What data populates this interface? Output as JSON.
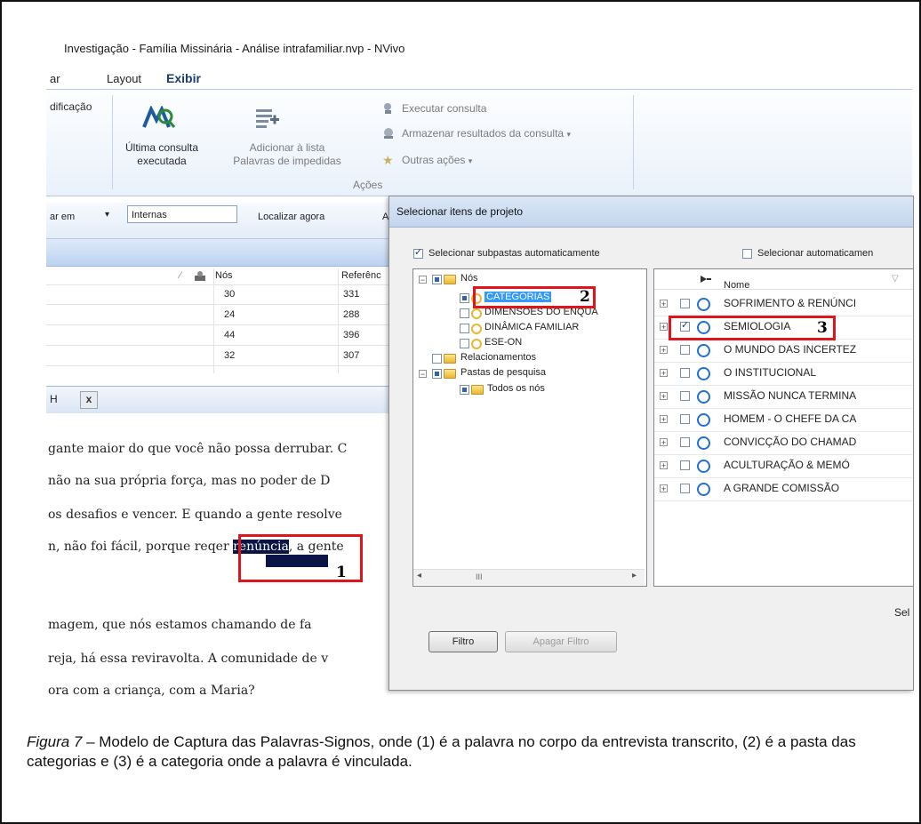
{
  "window": {
    "title": "Investigação - Família Missinária - Análise intrafamiliar.nvp - NVivo"
  },
  "menu": {
    "item1": "ar",
    "item2": "Layout",
    "item3": "Exibir"
  },
  "ribbon": {
    "modification": "dificação",
    "last_query_line1": "Última consulta",
    "last_query_line2": "executada",
    "add_list_line1": "Adicionar à lista",
    "add_list_line2": "Palavras de impedidas",
    "run_query": "Executar consulta",
    "store_results": "Armazenar resultados da consulta",
    "other_actions": "Outras ações",
    "group_label": "Ações"
  },
  "toolbar": {
    "search_in": "ar em",
    "scope_value": "Internas",
    "find_now": "Localizar agora",
    "clipped": "A"
  },
  "grid": {
    "col_nos": "Nós",
    "col_ref": "Referênc",
    "rows": [
      {
        "nos": "30",
        "ref": "331"
      },
      {
        "nos": "24",
        "ref": "288"
      },
      {
        "nos": "44",
        "ref": "396"
      },
      {
        "nos": "32",
        "ref": "307"
      }
    ]
  },
  "doctab": {
    "label": "H"
  },
  "document": {
    "line1": "gante maior do que você não possa derrubar. C",
    "line2": "não na sua própria força, mas no poder de D",
    "line3": "os desafios e vencer. E quando a gente resolve",
    "line4_pre": "n, não foi fácil, porque req",
    "line4_mid": "er ",
    "line4_hl": "renúncia",
    "line4_post": ", a gente",
    "line5": "magem, que nós estamos chamando de fa",
    "line6": "reja, há essa reviravolta. A comunidade de v",
    "line7": "ora com a criança, com a Maria?"
  },
  "dialog": {
    "title": "Selecionar itens de projeto",
    "auto_subfolders": "Selecionar subpastas automaticamente",
    "auto_select": "Selecionar automaticamen",
    "tree": {
      "nos": "Nós",
      "categorias": "CATEGORIAS",
      "dimensoes": "DIMENSÕES DO ENQUA",
      "dinamica": "DINÂMICA FAMILIAR",
      "eseon": "ESE-ON",
      "relacionamentos": "Relacionamentos",
      "pastas": "Pastas de pesquisa",
      "todos": "Todos os nós"
    },
    "list_header": "Nome",
    "list_items": [
      "SOFRIMENTO & RENÚNCI",
      "SEMIOLOGIA",
      "O MUNDO DAS INCERTEZ",
      "O INSTITUCIONAL",
      "MISSÃO NUNCA TERMINA",
      "HOMEM - O CHEFE DA CA",
      "CONVICÇÃO DO CHAMAD",
      "ACULTURAÇÃO & MEMÓ",
      "A GRANDE COMISSÃO"
    ],
    "sel_clipped": "Sel",
    "filter_button": "Filtro",
    "clear_filter_button": "Apagar Filtro",
    "scroll_mark": "III"
  },
  "annotations": {
    "n1": "1",
    "n2": "2",
    "n3": "3"
  },
  "caption": {
    "label": "Figura 7",
    "text": " – Modelo de Captura das Palavras-Signos, onde (1) é a palavra no corpo da entrevista transcrito, (2) é a pasta das categorias e (3) é a categoria onde a palavra é vinculada."
  }
}
